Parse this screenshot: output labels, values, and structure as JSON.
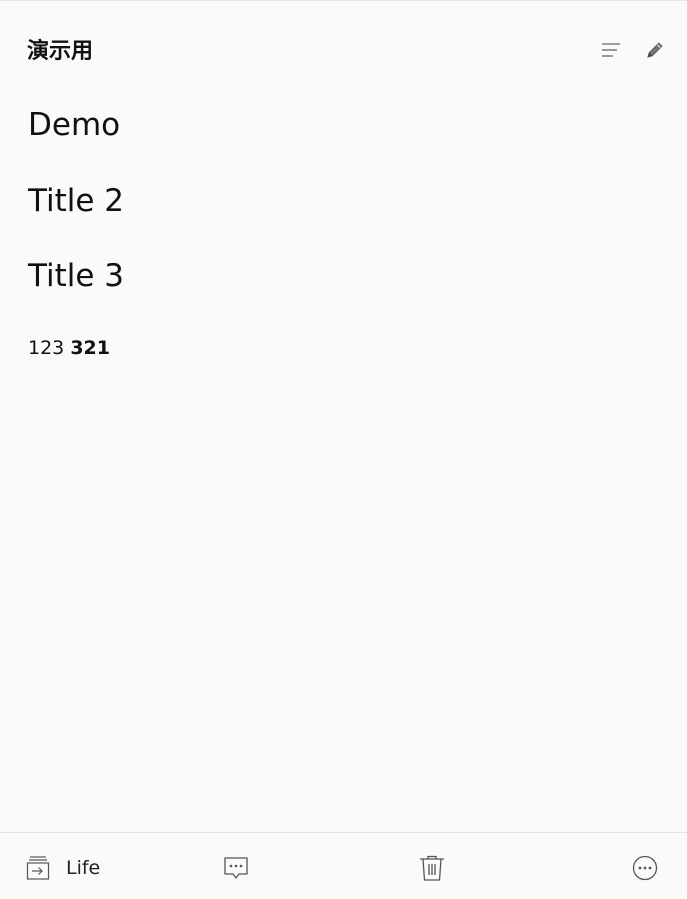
{
  "note": {
    "title": "演示用"
  },
  "header": {
    "outline_icon": "outline-icon",
    "edit_icon": "pencil-icon"
  },
  "content": {
    "heading1": "Demo",
    "heading2": "Title 2",
    "heading3": "Title 3",
    "paragraph_plain": "123 ",
    "paragraph_bold": "321"
  },
  "footer": {
    "notebook_icon": "move-to-notebook-icon",
    "notebook_label": "Life",
    "comment_icon": "comment-icon",
    "delete_icon": "trash-icon",
    "more_icon": "more-icon"
  },
  "colors": {
    "background": "#fafafa",
    "text": "#111111",
    "icon": "#555555",
    "divider": "#e3e3e3"
  }
}
